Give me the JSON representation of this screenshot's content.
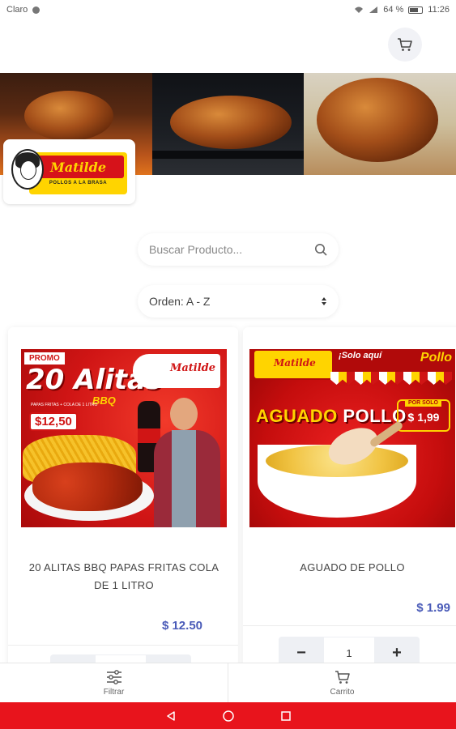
{
  "status_bar": {
    "carrier": "Claro",
    "battery": "64 %",
    "time": "11:26"
  },
  "header": {
    "cart_icon": "cart-icon"
  },
  "brand": {
    "logo_name": "Matilde",
    "logo_subtitle": "POLLOS A LA BRASA",
    "colors": {
      "red": "#d6121a",
      "yellow": "#ffd400"
    }
  },
  "search": {
    "placeholder": "Buscar Producto...",
    "icon": "search-icon"
  },
  "sort": {
    "selected": "Orden: A - Z",
    "icon": "updown-icon"
  },
  "products": [
    {
      "name": "20 ALITAS BBQ PAPAS FRITAS COLA DE 1 LITRO",
      "price": "$ 12.50",
      "image_text": {
        "promo": "PROMO",
        "title": "20 Alitas",
        "subtitle": "BBQ",
        "small": "PAPAS FRITAS + COLA DE 1 LITRO",
        "price": "$12,50",
        "brand": "Matilde"
      }
    },
    {
      "name": "AGUADO DE POLLO",
      "price": "$ 1.99",
      "quantity": "1",
      "image_text": {
        "brand": "Matilde",
        "solo": "¡Solo aquí",
        "pollo": "Pollo",
        "title_a": "AGUADO",
        "title_b": "POLLO",
        "por_solo": "POR SOLO",
        "price": "$ 1,99"
      }
    }
  ],
  "bottom_nav": {
    "filter_label": "Filtrar",
    "cart_label": "Carrito"
  },
  "accent_color": "#4a5bb8"
}
